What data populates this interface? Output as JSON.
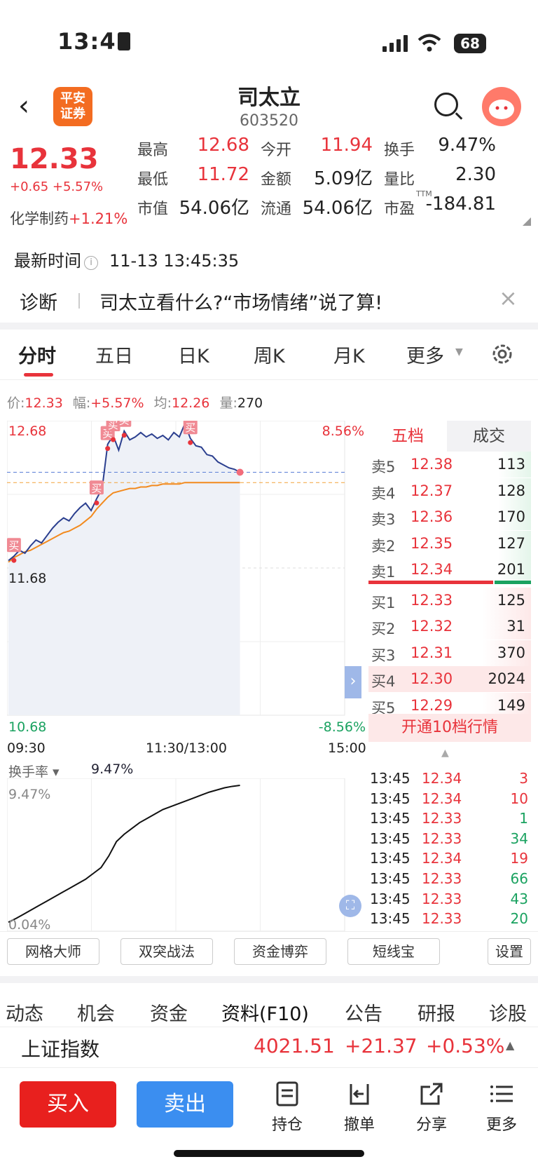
{
  "status_bar": {
    "time": "13:45",
    "battery": "68"
  },
  "header": {
    "logo_text": "平安证券",
    "stock_name": "司太立",
    "stock_code": "603520"
  },
  "quote": {
    "price": "12.33",
    "change": "+0.65 +5.57%",
    "industry_label": "化学制药",
    "industry_change": "+1.21%",
    "fields": [
      {
        "label": "最高",
        "value": "12.68",
        "color": "#e8333b"
      },
      {
        "label": "今开",
        "value": "11.94",
        "color": "#e8333b"
      },
      {
        "label": "换手",
        "value": "9.47%",
        "color": "#222222"
      },
      {
        "label": "最低",
        "value": "11.72",
        "color": "#e8333b"
      },
      {
        "label": "金额",
        "value": "5.09亿",
        "color": "#222222"
      },
      {
        "label": "量比",
        "value": "2.30",
        "color": "#222222"
      },
      {
        "label": "市值",
        "value": "54.06亿",
        "color": "#222222"
      },
      {
        "label": "流通",
        "value": "54.06亿",
        "color": "#222222"
      },
      {
        "label": "市盈",
        "value": "-184.81",
        "color": "#222222",
        "superscript": "TTM"
      }
    ]
  },
  "latest_time": {
    "label": "最新时间",
    "value": "11-13 13:45:35"
  },
  "banner": {
    "tag": "诊断",
    "text": "司太立看什么?“市场情绪”说了算!"
  },
  "chart_tabs": [
    "分时",
    "五日",
    "日K",
    "周K",
    "月K",
    "更多"
  ],
  "chart_info": {
    "price_label": "价:",
    "price": "12.33",
    "amp_label": "幅:",
    "amp": "+5.57%",
    "avg_label": "均:",
    "avg": "12.26",
    "vol_label": "量:",
    "vol": "270"
  },
  "chart_labels": {
    "y_top": "12.68",
    "y_mid": "11.68",
    "y_bottom": "10.68",
    "pct_top": "8.56%",
    "pct_bottom": "-8.56%",
    "x_start": "09:30",
    "x_mid": "11:30/13:00",
    "x_end": "15:00",
    "buy_mark": "买"
  },
  "chart_data": {
    "type": "line",
    "title": "",
    "xlabel": "",
    "ylabel": "",
    "ylim": [
      10.68,
      12.68
    ],
    "x_ticks": [
      "09:30",
      "11:30/13:00",
      "15:00"
    ],
    "series": [
      {
        "values": [
          11.73,
          11.76,
          11.8,
          11.78,
          11.83,
          11.87,
          11.85,
          11.9,
          11.95,
          11.99,
          12.02,
          12.0,
          12.05,
          12.09,
          12.12,
          12.07,
          12.15,
          12.22,
          12.52,
          12.58,
          12.48,
          12.61,
          12.55,
          12.57,
          12.6,
          12.57,
          12.59,
          12.56,
          12.58,
          12.55,
          12.6,
          12.57,
          12.66,
          12.56,
          12.51,
          12.5,
          12.45,
          12.44,
          12.4,
          12.38,
          12.36,
          12.35,
          12.33
        ]
      },
      {
        "values": [
          11.72,
          11.75,
          11.77,
          11.79,
          11.8,
          11.82,
          11.84,
          11.86,
          11.88,
          11.9,
          11.92,
          11.93,
          11.95,
          11.97,
          12.0,
          12.03,
          12.08,
          12.12,
          12.16,
          12.19,
          12.2,
          12.21,
          12.22,
          12.22,
          12.23,
          12.23,
          12.24,
          12.24,
          12.25,
          12.25,
          12.25,
          12.25,
          12.26,
          12.26,
          12.26,
          12.26,
          12.26,
          12.26,
          12.26,
          12.26,
          12.26,
          12.26,
          12.26
        ]
      }
    ],
    "reference_price": 11.68,
    "turnover": {
      "label": "换手率",
      "current": "9.47%",
      "max_label": "9.47%",
      "min_label": "0.04%",
      "values": [
        0.04,
        0.3,
        0.6,
        0.9,
        1.2,
        1.5,
        1.8,
        2.1,
        2.4,
        2.7,
        3.0,
        3.4,
        3.8,
        4.6,
        5.6,
        6.1,
        6.5,
        6.9,
        7.2,
        7.5,
        7.8,
        8.0,
        8.2,
        8.4,
        8.6,
        8.8,
        9.0,
        9.15,
        9.3,
        9.4,
        9.47
      ]
    }
  },
  "order_book": {
    "tabs": [
      "五档",
      "成交"
    ],
    "asks": [
      {
        "label": "卖5",
        "price": "12.38",
        "vol": "113"
      },
      {
        "label": "卖4",
        "price": "12.37",
        "vol": "128"
      },
      {
        "label": "卖3",
        "price": "12.36",
        "vol": "170"
      },
      {
        "label": "卖2",
        "price": "12.35",
        "vol": "127"
      },
      {
        "label": "卖1",
        "price": "12.34",
        "vol": "201"
      }
    ],
    "bids": [
      {
        "label": "买1",
        "price": "12.33",
        "vol": "125"
      },
      {
        "label": "买2",
        "price": "12.32",
        "vol": "31"
      },
      {
        "label": "买3",
        "price": "12.31",
        "vol": "370"
      },
      {
        "label": "买4",
        "price": "12.30",
        "vol": "2024"
      },
      {
        "label": "买5",
        "price": "12.29",
        "vol": "149"
      }
    ],
    "upgrade": "开通10档行情"
  },
  "trades": [
    {
      "time": "13:45",
      "price": "12.34",
      "vol": "3",
      "color": "#e8333b"
    },
    {
      "time": "13:45",
      "price": "12.34",
      "vol": "10",
      "color": "#e8333b"
    },
    {
      "time": "13:45",
      "price": "12.33",
      "vol": "1",
      "color": "#1aa260"
    },
    {
      "time": "13:45",
      "price": "12.33",
      "vol": "34",
      "color": "#1aa260"
    },
    {
      "time": "13:45",
      "price": "12.34",
      "vol": "19",
      "color": "#e8333b"
    },
    {
      "time": "13:45",
      "price": "12.33",
      "vol": "66",
      "color": "#1aa260"
    },
    {
      "time": "13:45",
      "price": "12.33",
      "vol": "43",
      "color": "#1aa260"
    },
    {
      "time": "13:45",
      "price": "12.33",
      "vol": "20",
      "color": "#1aa260"
    }
  ],
  "tools": [
    "网格大师",
    "双突战法",
    "资金博弈",
    "短线宝",
    "设置"
  ],
  "section_tabs": [
    "动态",
    "机会",
    "资金",
    "资料(F10)",
    "公告",
    "研报",
    "诊股"
  ],
  "index": {
    "name": "上证指数",
    "value": "4021.51",
    "change": "+21.37",
    "pct": "+0.53%"
  },
  "bottom": {
    "buy": "买入",
    "sell": "卖出",
    "items": [
      "持仓",
      "撤单",
      "分享",
      "更多"
    ]
  }
}
